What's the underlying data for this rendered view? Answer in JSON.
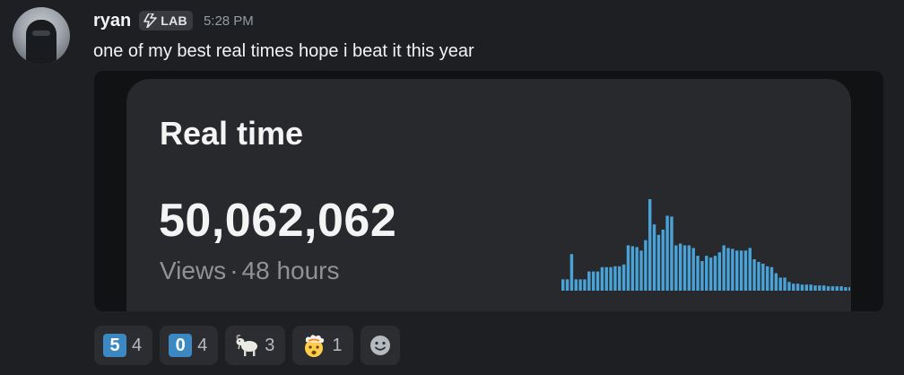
{
  "user": {
    "name": "ryan",
    "tag_label": "LAB",
    "tag_icon": "lightning-icon",
    "timestamp": "5:28 PM"
  },
  "message": {
    "text": "one of my best real times hope i beat it this year"
  },
  "embed": {
    "title": "Real time",
    "value": "50,062,062",
    "views_label": "Views",
    "separator": "·",
    "period": "48 hours"
  },
  "chart_data": {
    "type": "bar",
    "bar_color": "#4aa3d8",
    "values": [
      13,
      13,
      42,
      13,
      13,
      13,
      22,
      22,
      22,
      27,
      27,
      27,
      28,
      28,
      30,
      52,
      51,
      50,
      46,
      58,
      105,
      76,
      64,
      70,
      86,
      85,
      52,
      54,
      52,
      52,
      49,
      40,
      34,
      40,
      38,
      40,
      44,
      52,
      49,
      48,
      46,
      46,
      46,
      49,
      36,
      33,
      31,
      28,
      27,
      20,
      15,
      15,
      10,
      8,
      8,
      7,
      7,
      7,
      6,
      6,
      6,
      5,
      5,
      5,
      5,
      4,
      4
    ]
  },
  "reactions": [
    {
      "emoji_label": "5",
      "emoji_name": "keycap-5-emoji",
      "count": "4"
    },
    {
      "emoji_label": "0",
      "emoji_name": "keycap-0-emoji",
      "count": "4"
    },
    {
      "emoji_name": "goat-emoji",
      "count": "3"
    },
    {
      "emoji_name": "exploding-head-emoji",
      "count": "1"
    }
  ],
  "add_reaction_icon": "smiley-add-icon"
}
